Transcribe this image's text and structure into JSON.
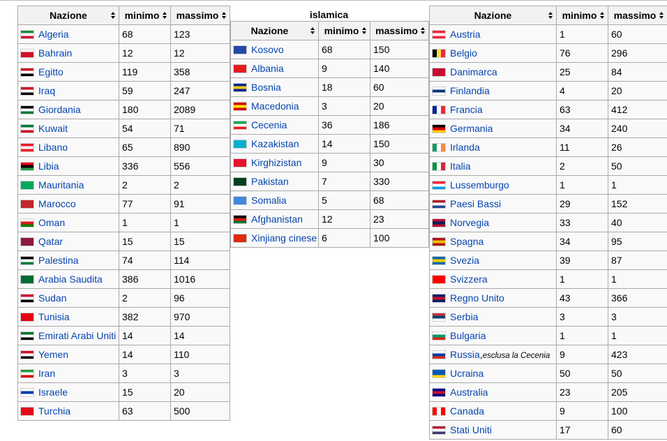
{
  "headers": {
    "nation": "Nazione",
    "min": "minimo",
    "max": "massimo"
  },
  "middle_caption": "islamica",
  "left_table": [
    {
      "name": "Algeria",
      "min": "68",
      "max": "123",
      "flag": "algeria-flag-icon",
      "c": [
        "#1d8a3d",
        "#ffffff",
        "#d21034"
      ]
    },
    {
      "name": "Bahrain",
      "min": "12",
      "max": "12",
      "flag": "bahrain-flag-icon",
      "c": [
        "#ffffff",
        "#ce1126",
        "#ce1126"
      ]
    },
    {
      "name": "Egitto",
      "min": "119",
      "max": "358",
      "flag": "egypt-flag-icon",
      "c": [
        "#ce1126",
        "#ffffff",
        "#000000"
      ]
    },
    {
      "name": "Iraq",
      "min": "59",
      "max": "247",
      "flag": "iraq-flag-icon",
      "c": [
        "#ce1126",
        "#ffffff",
        "#000000"
      ]
    },
    {
      "name": "Giordania",
      "min": "180",
      "max": "2089",
      "flag": "jordan-flag-icon",
      "c": [
        "#000000",
        "#ffffff",
        "#007a3d"
      ]
    },
    {
      "name": "Kuwait",
      "min": "54",
      "max": "71",
      "flag": "kuwait-flag-icon",
      "c": [
        "#007a3d",
        "#ffffff",
        "#ce1126"
      ]
    },
    {
      "name": "Libano",
      "min": "65",
      "max": "890",
      "flag": "lebanon-flag-icon",
      "c": [
        "#ed1c24",
        "#ffffff",
        "#ed1c24"
      ]
    },
    {
      "name": "Libia",
      "min": "336",
      "max": "556",
      "flag": "libya-flag-icon",
      "c": [
        "#e70013",
        "#000000",
        "#239e46"
      ]
    },
    {
      "name": "Mauritania",
      "min": "2",
      "max": "2",
      "flag": "mauritania-flag-icon",
      "c": [
        "#00a95c",
        "#00a95c",
        "#00a95c"
      ]
    },
    {
      "name": "Marocco",
      "min": "77",
      "max": "91",
      "flag": "morocco-flag-icon",
      "c": [
        "#c1272d",
        "#c1272d",
        "#c1272d"
      ]
    },
    {
      "name": "Oman",
      "min": "1",
      "max": "1",
      "flag": "oman-flag-icon",
      "c": [
        "#ffffff",
        "#db161b",
        "#008000"
      ]
    },
    {
      "name": "Qatar",
      "min": "15",
      "max": "15",
      "flag": "qatar-flag-icon",
      "c": [
        "#8d1b3d",
        "#8d1b3d",
        "#8d1b3d"
      ]
    },
    {
      "name": "Palestina",
      "min": "74",
      "max": "114",
      "flag": "palestine-flag-icon",
      "c": [
        "#000000",
        "#ffffff",
        "#007a3d"
      ]
    },
    {
      "name": "Arabia Saudita",
      "min": "386",
      "max": "1016",
      "flag": "saudi-arabia-flag-icon",
      "c": [
        "#006c35",
        "#006c35",
        "#006c35"
      ]
    },
    {
      "name": "Sudan",
      "min": "2",
      "max": "96",
      "flag": "sudan-flag-icon",
      "c": [
        "#d21034",
        "#ffffff",
        "#000000"
      ]
    },
    {
      "name": "Tunisia",
      "min": "382",
      "max": "970",
      "flag": "tunisia-flag-icon",
      "c": [
        "#e70013",
        "#e70013",
        "#e70013"
      ]
    },
    {
      "name": "Emirati Arabi Uniti",
      "min": "14",
      "max": "14",
      "flag": "uae-flag-icon",
      "c": [
        "#00732f",
        "#ffffff",
        "#000000"
      ]
    },
    {
      "name": "Yemen",
      "min": "14",
      "max": "110",
      "flag": "yemen-flag-icon",
      "c": [
        "#ce1126",
        "#ffffff",
        "#000000"
      ]
    },
    {
      "name": "Iran",
      "min": "3",
      "max": "3",
      "flag": "iran-flag-icon",
      "c": [
        "#239f40",
        "#ffffff",
        "#da0000"
      ]
    },
    {
      "name": "Israele",
      "min": "15",
      "max": "20",
      "flag": "israel-flag-icon",
      "c": [
        "#ffffff",
        "#0038b8",
        "#ffffff"
      ]
    },
    {
      "name": "Turchia",
      "min": "63",
      "max": "500",
      "flag": "turkey-flag-icon",
      "c": [
        "#e30a17",
        "#e30a17",
        "#e30a17"
      ]
    }
  ],
  "middle_table": [
    {
      "name": "Kosovo",
      "min": "68",
      "max": "150",
      "flag": "kosovo-flag-icon",
      "c": [
        "#244aa5",
        "#244aa5",
        "#244aa5"
      ]
    },
    {
      "name": "Albania",
      "min": "9",
      "max": "140",
      "flag": "albania-flag-icon",
      "c": [
        "#e41e20",
        "#e41e20",
        "#e41e20"
      ]
    },
    {
      "name": "Bosnia",
      "min": "18",
      "max": "60",
      "flag": "bosnia-flag-icon",
      "c": [
        "#002395",
        "#fecb00",
        "#002395"
      ]
    },
    {
      "name": "Macedonia",
      "min": "3",
      "max": "20",
      "flag": "macedonia-flag-icon",
      "c": [
        "#d20000",
        "#ffe600",
        "#d20000"
      ]
    },
    {
      "name": "Cecenia",
      "min": "36",
      "max": "186",
      "flag": "chechnya-flag-icon",
      "c": [
        "#00a651",
        "#ffffff",
        "#ed1c24"
      ]
    },
    {
      "name": "Kazakistan",
      "min": "14",
      "max": "150",
      "flag": "kazakhstan-flag-icon",
      "c": [
        "#00afca",
        "#00afca",
        "#00afca"
      ]
    },
    {
      "name": "Kirghizistan",
      "min": "9",
      "max": "30",
      "flag": "kyrgyzstan-flag-icon",
      "c": [
        "#e8112d",
        "#e8112d",
        "#e8112d"
      ]
    },
    {
      "name": "Pakistan",
      "min": "7",
      "max": "330",
      "flag": "pakistan-flag-icon",
      "c": [
        "#01411c",
        "#01411c",
        "#01411c"
      ]
    },
    {
      "name": "Somalia",
      "min": "5",
      "max": "68",
      "flag": "somalia-flag-icon",
      "c": [
        "#4189dd",
        "#4189dd",
        "#4189dd"
      ]
    },
    {
      "name": "Afghanistan",
      "min": "12",
      "max": "23",
      "flag": "afghanistan-flag-icon",
      "c": [
        "#000000",
        "#d32011",
        "#007a36"
      ]
    },
    {
      "name": "Xinjiang cinese",
      "min": "6",
      "max": "100",
      "flag": "china-flag-icon",
      "c": [
        "#de2910",
        "#de2910",
        "#de2910"
      ]
    }
  ],
  "right_table": [
    {
      "name": "Austria",
      "min": "1",
      "max": "60",
      "flag": "austria-flag-icon",
      "c": [
        "#ed2939",
        "#ffffff",
        "#ed2939"
      ]
    },
    {
      "name": "Belgio",
      "min": "76",
      "max": "296",
      "flag": "belgium-flag-icon",
      "c": [
        "#000000",
        "#fae042",
        "#ed2939"
      ],
      "v": true
    },
    {
      "name": "Danimarca",
      "min": "25",
      "max": "84",
      "flag": "denmark-flag-icon",
      "c": [
        "#c60c30",
        "#c60c30",
        "#c60c30"
      ]
    },
    {
      "name": "Finlandia",
      "min": "4",
      "max": "20",
      "flag": "finland-flag-icon",
      "c": [
        "#ffffff",
        "#003580",
        "#ffffff"
      ]
    },
    {
      "name": "Francia",
      "min": "63",
      "max": "412",
      "flag": "france-flag-icon",
      "c": [
        "#002395",
        "#ffffff",
        "#ed2939"
      ],
      "v": true
    },
    {
      "name": "Germania",
      "min": "34",
      "max": "240",
      "flag": "germany-flag-icon",
      "c": [
        "#000000",
        "#dd0000",
        "#ffce00"
      ]
    },
    {
      "name": "Irlanda",
      "min": "11",
      "max": "26",
      "flag": "ireland-flag-icon",
      "c": [
        "#169b62",
        "#ffffff",
        "#ff883e"
      ],
      "v": true
    },
    {
      "name": "Italia",
      "min": "2",
      "max": "50",
      "flag": "italy-flag-icon",
      "c": [
        "#009246",
        "#ffffff",
        "#ce2b37"
      ],
      "v": true
    },
    {
      "name": "Lussemburgo",
      "min": "1",
      "max": "1",
      "flag": "luxembourg-flag-icon",
      "c": [
        "#ed2939",
        "#ffffff",
        "#00a1de"
      ]
    },
    {
      "name": "Paesi Bassi",
      "min": "29",
      "max": "152",
      "flag": "netherlands-flag-icon",
      "c": [
        "#ae1c28",
        "#ffffff",
        "#21468b"
      ]
    },
    {
      "name": "Norvegia",
      "min": "33",
      "max": "40",
      "flag": "norway-flag-icon",
      "c": [
        "#ba0c2f",
        "#00205b",
        "#ba0c2f"
      ]
    },
    {
      "name": "Spagna",
      "min": "34",
      "max": "95",
      "flag": "spain-flag-icon",
      "c": [
        "#aa151b",
        "#f1bf00",
        "#aa151b"
      ]
    },
    {
      "name": "Svezia",
      "min": "39",
      "max": "87",
      "flag": "sweden-flag-icon",
      "c": [
        "#006aa7",
        "#fecc00",
        "#006aa7"
      ]
    },
    {
      "name": "Svizzera",
      "min": "1",
      "max": "1",
      "flag": "switzerland-flag-icon",
      "c": [
        "#ff0000",
        "#ff0000",
        "#ff0000"
      ]
    },
    {
      "name": "Regno Unito",
      "min": "43",
      "max": "366",
      "flag": "uk-flag-icon",
      "c": [
        "#012169",
        "#c8102e",
        "#012169"
      ]
    },
    {
      "name": "Serbia",
      "min": "3",
      "max": "3",
      "flag": "serbia-flag-icon",
      "c": [
        "#c6363c",
        "#0c4076",
        "#ffffff"
      ]
    },
    {
      "name": "Bulgaria",
      "min": "1",
      "max": "1",
      "flag": "bulgaria-flag-icon",
      "c": [
        "#ffffff",
        "#00966e",
        "#d62612"
      ]
    },
    {
      "name": "Russia",
      "note": "esclusa la Cecenia",
      "min": "9",
      "max": "423",
      "flag": "russia-flag-icon",
      "c": [
        "#ffffff",
        "#0039a6",
        "#d52b1e"
      ]
    },
    {
      "name": "Ucraina",
      "min": "50",
      "max": "50",
      "flag": "ukraine-flag-icon",
      "c": [
        "#0057b7",
        "#0057b7",
        "#ffd700"
      ]
    },
    {
      "name": "Australia",
      "min": "23",
      "max": "205",
      "flag": "australia-flag-icon",
      "c": [
        "#00008b",
        "#c8102e",
        "#00008b"
      ]
    },
    {
      "name": "Canada",
      "min": "9",
      "max": "100",
      "flag": "canada-flag-icon",
      "c": [
        "#ff0000",
        "#ffffff",
        "#ff0000"
      ],
      "v": true
    },
    {
      "name": "Stati Uniti",
      "min": "17",
      "max": "60",
      "flag": "usa-flag-icon",
      "c": [
        "#b22234",
        "#ffffff",
        "#3c3b6e"
      ]
    }
  ]
}
